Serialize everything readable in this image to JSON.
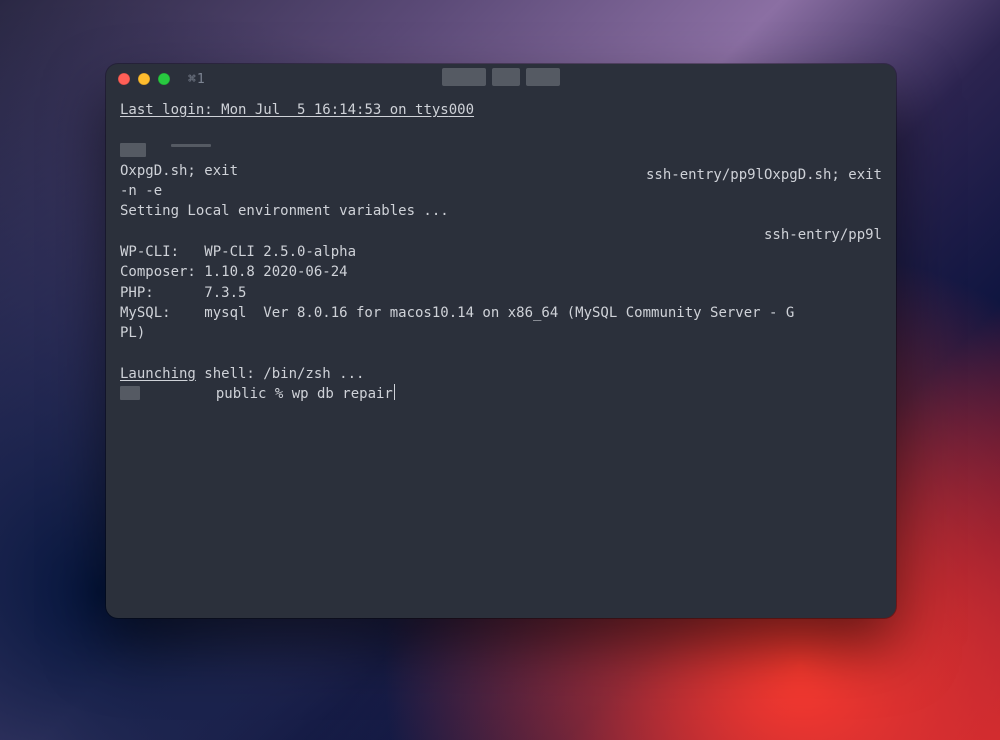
{
  "window": {
    "tab_label": "⌘1"
  },
  "right": {
    "line1": "ssh-entry/pp9lOxpgD.sh; exit",
    "line2": "ssh-entry/pp9l"
  },
  "term": {
    "last_login_prefix": "Last login: Mon Jul  5",
    "last_login_time": " 16:14:53 on ttys",
    "last_login_tty": "000",
    "l_oxpgd": "OxpgD.sh; exit",
    "l_ne": "-n -e",
    "l_setenv": "Setting Local environment variables ...",
    "l_wpcli": "WP-CLI:   WP-CLI 2.5.0-alpha",
    "l_composer": "Composer: 1.10.8 2020-06-24",
    "l_php": "PHP:      7.3.5",
    "l_mysql": "MySQL:    mysql  Ver 8.0.16 for macos10.14 on x86_64 (MySQL Community Server - G",
    "l_mysql2": "PL)",
    "l_launch_pre": "Launching",
    "l_launch_post": " shell: /bin/zsh ...",
    "prompt": "         public % wp db repair"
  }
}
